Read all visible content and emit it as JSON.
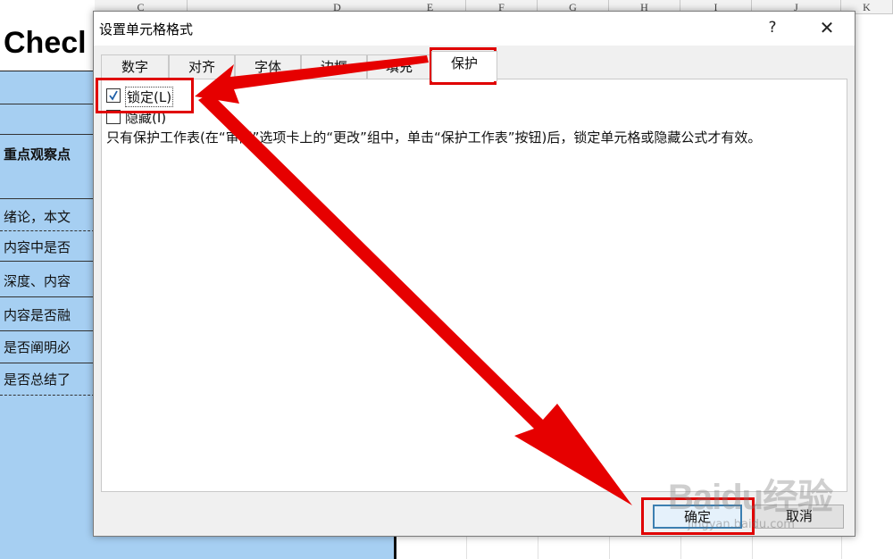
{
  "sheet": {
    "columns": [
      "C",
      "D",
      "E",
      "F",
      "G",
      "H",
      "I",
      "J",
      "K"
    ],
    "title_cell": "Checl",
    "cells": [
      "重点观察点",
      "绪论，本文",
      "内容中是否",
      "深度、内容",
      "内容是否融",
      "是否阐明必",
      "是否总结了"
    ]
  },
  "dialog": {
    "title": "设置单元格格式",
    "help_label": "?",
    "close_label": "✕",
    "tabs": [
      "数字",
      "对齐",
      "字体",
      "边框",
      "填充",
      "保护"
    ],
    "active_tab": "保护",
    "protection": {
      "locked_label": "锁定(L)",
      "locked_checked": true,
      "hidden_label": "隐藏(I)",
      "hidden_checked": false,
      "note": "只有保护工作表(在“审阅”选项卡上的“更改”组中，单击“保护工作表”按钮)后，锁定单元格或隐藏公式才有效。"
    },
    "buttons": {
      "ok": "确定",
      "cancel": "取消"
    }
  },
  "annotation": {
    "color": "#e00000"
  },
  "watermark": {
    "brand": "Baidu经验",
    "url": "jingyan.baidu.com"
  }
}
